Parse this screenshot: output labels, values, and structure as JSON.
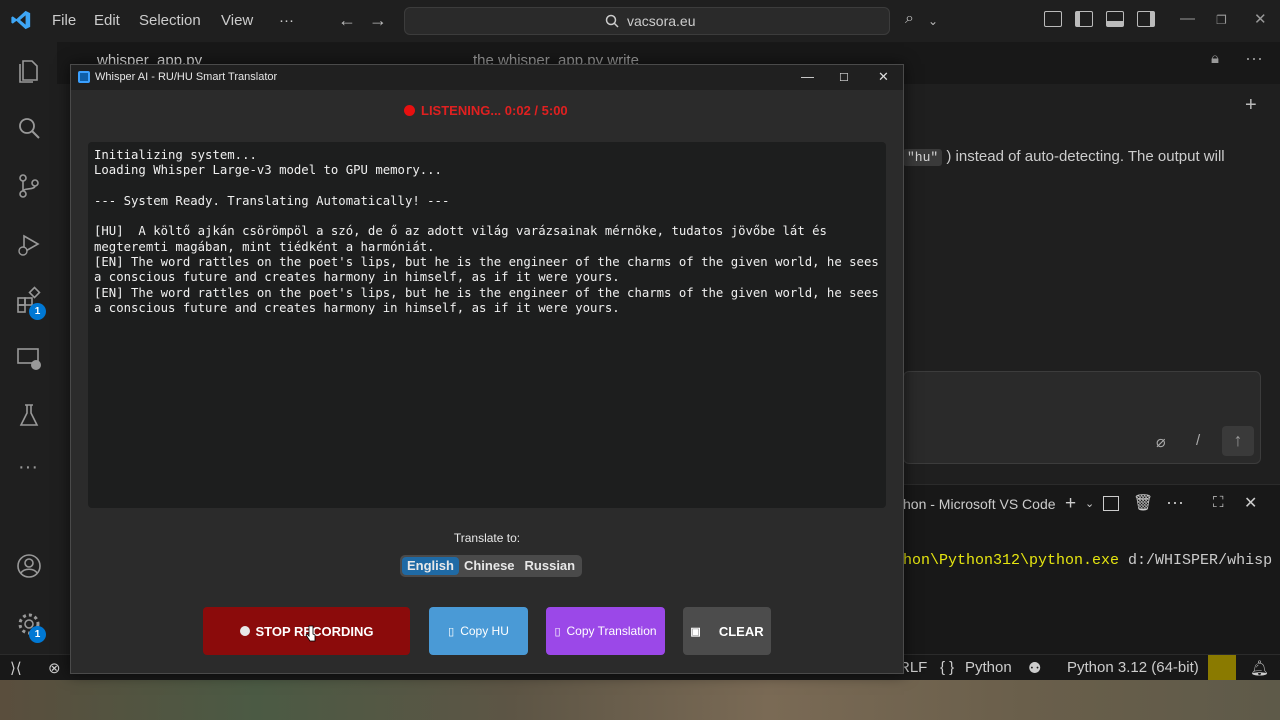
{
  "vscode": {
    "menu": [
      "File",
      "Edit",
      "Selection",
      "View",
      "···"
    ],
    "search": "vacsora.eu",
    "tabs": {
      "left": "whisper_app.py",
      "right": "the whisper_app.py write"
    },
    "chat_text_pre": "\"hu\"",
    "chat_text_post": ") instead of auto-detecting. The output will",
    "terminal_title": "hon - Microsoft VS Code",
    "terminal_line_yellow": "hon\\Python312\\python.exe",
    "terminal_line_rest": " d:/WHISPER/whisp",
    "activity_badges": {
      "extensions": "1",
      "settings": "1"
    },
    "status": {
      "eol": "RLF",
      "lang": "Python",
      "interpreter": "Python 3.12 (64-bit)",
      "braces": "{ }"
    }
  },
  "whisper": {
    "title": "Whisper AI - RU/HU Smart Translator",
    "listening": "LISTENING... 0:02 / 5:00",
    "log_lines": [
      "Initializing system...",
      "Loading Whisper Large-v3 model to GPU memory...",
      "",
      "--- System Ready. Translating Automatically! ---",
      "",
      "[HU]  A költő ajkán csörömpöl a szó, de ő az adott világ varázsainak mérnöke, tudatos jövőbe lát és",
      "megteremti magában, mint tiédként a harmóniát.",
      "[EN] The word rattles on the poet's lips, but he is the engineer of the charms of the given world, he sees",
      "a conscious future and creates harmony in himself, as if it were yours.",
      "[EN] The word rattles on the poet's lips, but he is the engineer of the charms of the given world, he sees",
      "a conscious future and creates harmony in himself, as if it were yours."
    ],
    "translate_label": "Translate to:",
    "languages": [
      "English",
      "Chinese",
      "Russian"
    ],
    "selected_language": "English",
    "buttons": {
      "stop": "STOP RECORDING",
      "copy_hu": "Copy HU",
      "copy_translation": "Copy Translation",
      "clear": "CLEAR"
    }
  },
  "colors": {
    "stop": "#8b0b0b",
    "copy_hu": "#4a9ad6",
    "copy_translation": "#9b48e8",
    "clear": "#4c4c4c",
    "listening": "#e02020",
    "selected_lang": "#1f6aa5"
  }
}
